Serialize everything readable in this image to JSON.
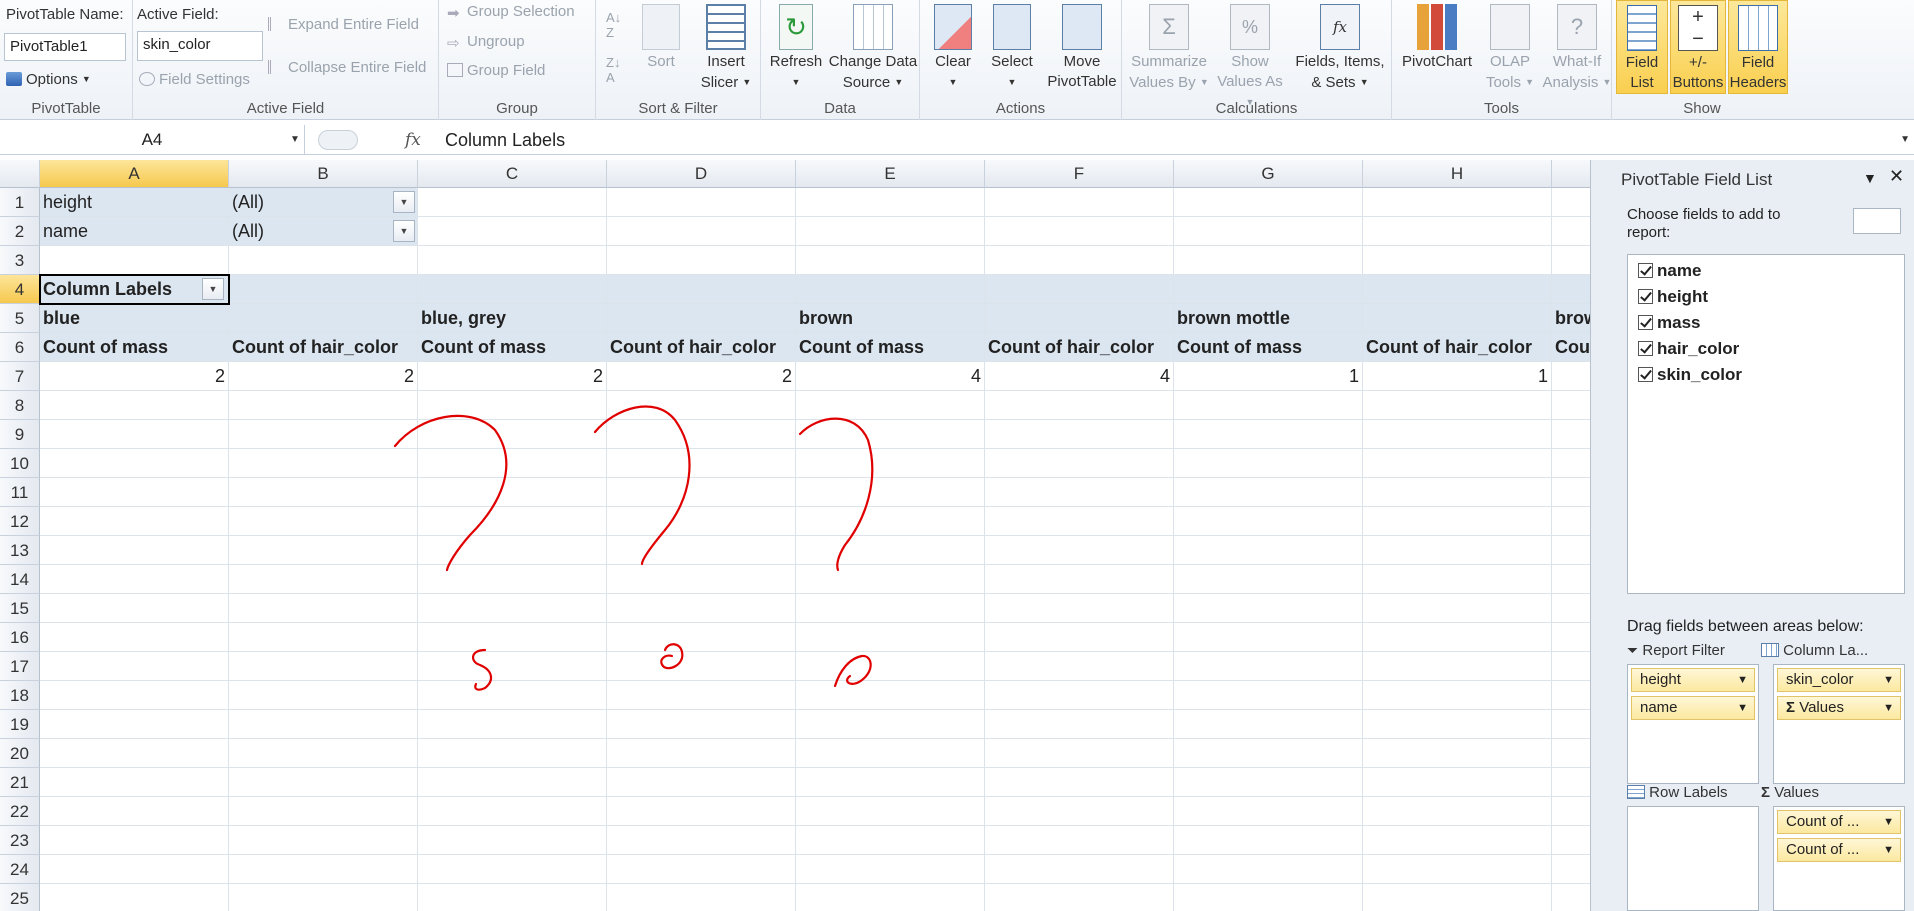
{
  "ribbon": {
    "pivot_name_label": "PivotTable Name:",
    "pivot_name_value": "PivotTable1",
    "options_label": "Options",
    "group_pivottable": "PivotTable",
    "active_field_label": "Active Field:",
    "active_field_value": "skin_color",
    "field_settings": "Field Settings",
    "expand_entire_field": "Expand Entire Field",
    "collapse_entire_field": "Collapse Entire Field",
    "group_active_field": "Active Field",
    "group_selection": "Group Selection",
    "ungroup": "Ungroup",
    "group_field": "Group Field",
    "group_group": "Group",
    "sort": "Sort",
    "insert_slicer": [
      "Insert",
      "Slicer"
    ],
    "group_sort_filter": "Sort & Filter",
    "refresh": "Refresh",
    "change_data_source": [
      "Change Data",
      "Source"
    ],
    "group_data": "Data",
    "clear": "Clear",
    "select": "Select",
    "move_pivottable": [
      "Move",
      "PivotTable"
    ],
    "group_actions": "Actions",
    "summarize_values_by": [
      "Summarize",
      "Values By"
    ],
    "show_values_as": [
      "Show",
      "Values As"
    ],
    "fields_items_sets": [
      "Fields, Items,",
      "& Sets"
    ],
    "group_calculations": "Calculations",
    "pivotchart": "PivotChart",
    "olap_tools": [
      "OLAP",
      "Tools"
    ],
    "what_if_analysis": [
      "What-If",
      "Analysis"
    ],
    "group_tools": "Tools",
    "field_list": [
      "Field",
      "List"
    ],
    "plus_minus_buttons": [
      "+/-",
      "Buttons"
    ],
    "field_headers": [
      "Field",
      "Headers"
    ],
    "group_show": "Show"
  },
  "formula_bar": {
    "name_box": "A4",
    "fx": "fx",
    "content": "Column Labels"
  },
  "columns": [
    "A",
    "B",
    "C",
    "D",
    "E",
    "F",
    "G",
    "H"
  ],
  "rows": [
    "1",
    "2",
    "3",
    "4",
    "5",
    "6",
    "7",
    "8",
    "9",
    "10",
    "11",
    "12",
    "13",
    "14",
    "15",
    "16",
    "17",
    "18",
    "19",
    "20",
    "21",
    "22",
    "23",
    "24",
    "25"
  ],
  "cells": {
    "A1": "height",
    "B1": "(All)",
    "A2": "name",
    "B2": "(All)",
    "A4": "Column Labels",
    "A5": "blue",
    "C5": "blue, grey",
    "E5": "brown",
    "G5": "brown mottle",
    "I5": "brow",
    "A6": "Count of mass",
    "B6": "Count of hair_color",
    "C6": "Count of mass",
    "D6": "Count of hair_color",
    "E6": "Count of mass",
    "F6": "Count of hair_color",
    "G6": "Count of mass",
    "H6": "Count of hair_color",
    "I6": "Cou",
    "A7": "2",
    "B7": "2",
    "C7": "2",
    "D7": "2",
    "E7": "4",
    "F7": "4",
    "G7": "1",
    "H7": "1"
  },
  "field_list": {
    "title": "PivotTable Field List",
    "choose_text": "Choose fields to add to report:",
    "fields": [
      "name",
      "height",
      "mass",
      "hair_color",
      "skin_color"
    ],
    "drag_text": "Drag fields between areas below:",
    "report_filter_label": "Report Filter",
    "column_labels_label": "Column La...",
    "row_labels_label": "Row Labels",
    "values_label": "Values",
    "report_filter_items": [
      "height",
      "name"
    ],
    "column_label_items": [
      "skin_color",
      "Values"
    ],
    "values_items": [
      "Count of ...",
      "Count of ..."
    ]
  },
  "colors": {
    "pivot_header": "#dce6f1",
    "active_tab": "#f9cf4f",
    "annotation_red": "#e00000"
  }
}
